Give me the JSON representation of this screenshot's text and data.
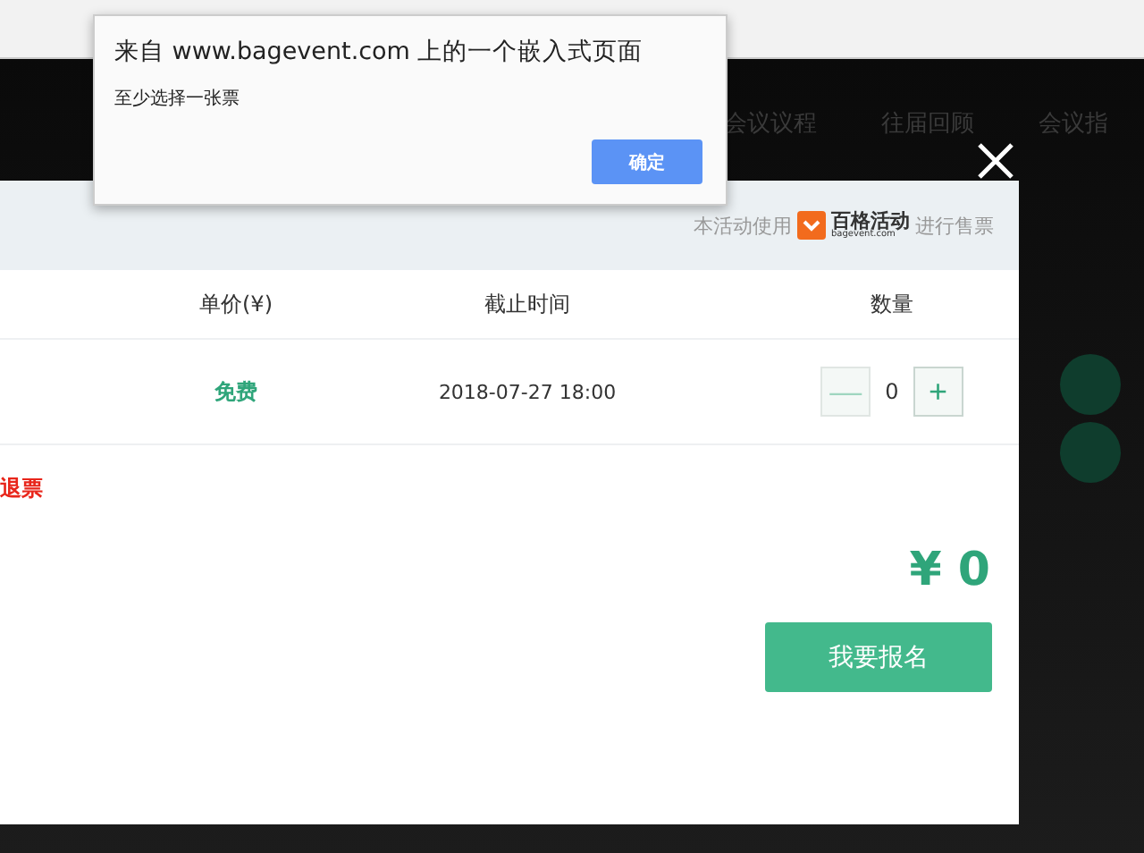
{
  "nav": [
    "会议议程",
    "往届回顾",
    "会议指"
  ],
  "modal": {
    "provider_prefix": "本活动使用",
    "provider_name": "百格活动",
    "provider_url": "bagevent.com",
    "provider_suffix": "进行售票",
    "columns": [
      "单价(¥)",
      "截止时间",
      "数量"
    ],
    "tickets": [
      {
        "price": "免费",
        "deadline": "2018-07-27 18:00",
        "minus": "—",
        "quantity": "0",
        "plus": "+",
        "minus_disabled": true
      }
    ],
    "refund_note": "退票",
    "total": "¥ 0",
    "submit": "我要报名"
  },
  "alert": {
    "title": "来自 www.bagevent.com 上的一个嵌入式页面",
    "message": "至少选择一张票",
    "ok": "确定"
  }
}
